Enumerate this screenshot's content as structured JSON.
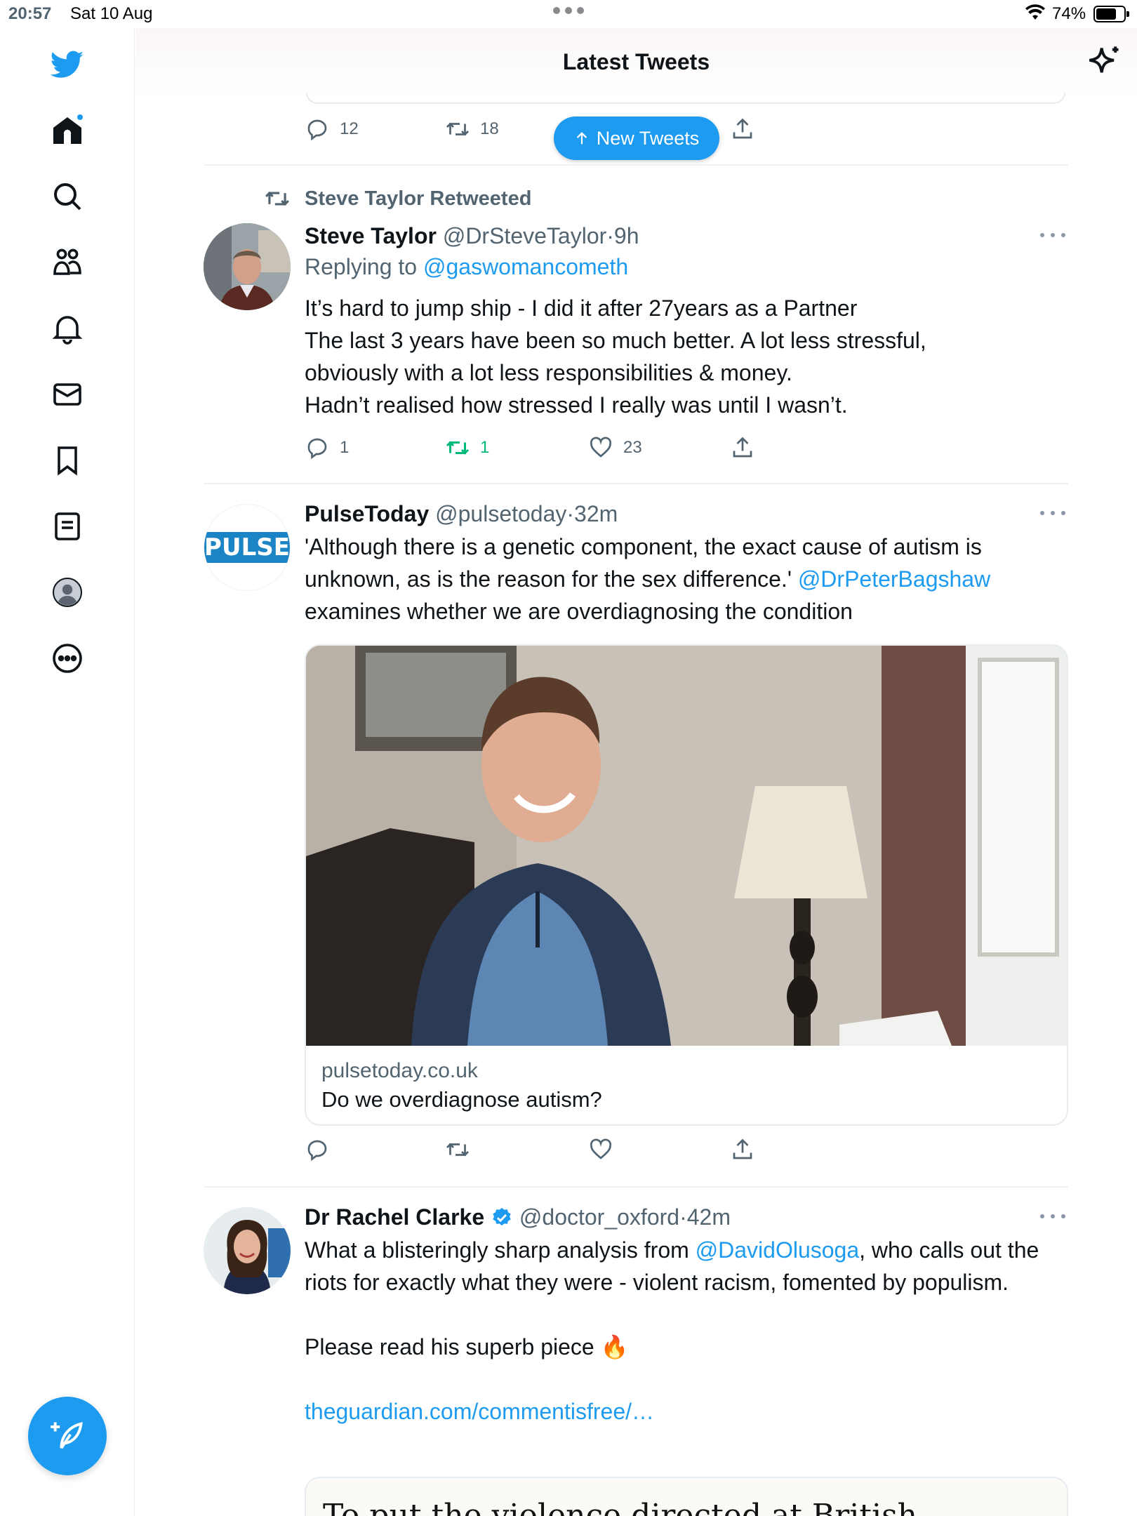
{
  "status_bar": {
    "time": "20:57",
    "date": "Sat 10 Aug",
    "battery": "74%",
    "battery_level": 0.74
  },
  "sidebar": {
    "items": [
      {
        "icon": "twitter-bird-icon"
      },
      {
        "icon": "home-icon",
        "has_notification_dot": true
      },
      {
        "icon": "search-icon"
      },
      {
        "icon": "communities-icon"
      },
      {
        "icon": "bell-icon"
      },
      {
        "icon": "mail-icon"
      },
      {
        "icon": "bookmark-icon"
      },
      {
        "icon": "lists-icon"
      },
      {
        "icon": "profile-avatar-icon"
      },
      {
        "icon": "more-circle-icon"
      }
    ],
    "compose_icon": "compose-feather-icon"
  },
  "header": {
    "title": "Latest Tweets",
    "sparkle_icon": "sparkle-icon"
  },
  "previous_tweet": {
    "replies": "12",
    "retweets": "18"
  },
  "new_tweets_pill": {
    "label": "New Tweets",
    "icon": "arrow-up-icon"
  },
  "tweets": [
    {
      "retweeted_by": "Steve Taylor Retweeted",
      "name": "Steve Taylor",
      "handle": "@DrSteveTaylor",
      "separator": "·",
      "time": "9h",
      "replying_prefix": "Replying to",
      "replying_to": "@gaswomancometh",
      "lines": [
        "It’s hard to jump ship - I did it after 27years as a Partner",
        "The last 3 years have been so much better. A lot less stressful,",
        "obviously with a lot less responsibilities & money.",
        "Hadn’t realised how stressed I really was until I wasn’t."
      ],
      "replies": "1",
      "retweets": "1",
      "likes": "23"
    },
    {
      "name": "PulseToday",
      "handle": "@pulsetoday",
      "separator": "·",
      "time": "32m",
      "avatar_text": "PULSE",
      "text_part1": "'Although there is a genetic component, the exact cause of autism is unknown, as is the reason for the sex difference.' ",
      "mention": "@DrPeterBagshaw",
      "text_part2": "examines whether we are overdiagnosing the condition",
      "card": {
        "domain": "pulsetoday.co.uk",
        "headline": "Do we overdiagnose autism?"
      }
    },
    {
      "name": "Dr Rachel Clarke",
      "verified_icon": "verified-badge-icon",
      "handle": "@doctor_oxford",
      "separator": "·",
      "time": "42m",
      "text_part1": "What a blisteringly sharp analysis from ",
      "mention": "@DavidOlusoga",
      "text_part2": ", who calls out the riots for exactly what they were - violent racism, fomented by populism.",
      "text_part3": "Please read his superb piece",
      "emoji": "🔥",
      "link": "theguardian.com/commentisfree/…",
      "card_headline": "To put the violence directed at British"
    }
  ]
}
